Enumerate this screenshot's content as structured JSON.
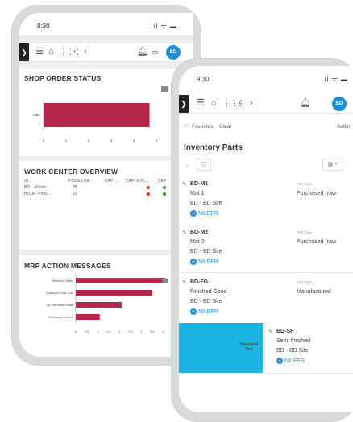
{
  "back_phone": {
    "time": "9:30",
    "signal": ".ıl ᯤ ▬",
    "avatar": "BD",
    "shop_order": {
      "title": "SHOP ORDER STATUS",
      "bar_label": "Late",
      "value": 4.7,
      "ticks": [
        "0",
        "1",
        "2",
        "3",
        "4",
        "5",
        "6"
      ]
    },
    "work_center": {
      "title": "WORK CENTER OVERVIEW",
      "headers": [
        "ID",
        "PIOUE LOA...",
        "CAP. ...",
        "CAP. % PI...",
        "CAP"
      ],
      "rows": [
        {
          "id": "BD1 - Produ...",
          "load": "25",
          "c1": "red",
          "c2": "green"
        },
        {
          "id": "BD1A - Prod...",
          "load": "13",
          "c1": "red",
          "c2": "green"
        }
      ]
    },
    "mrp": {
      "title": "MRP ACTION MESSAGES",
      "ticks": [
        "0",
        "0.5",
        "1",
        "1.5",
        "2",
        "2.5",
        "3",
        "3.5",
        "4",
        "4.5"
      ],
      "bar_color": "#b5264a"
    }
  },
  "chart_data": [
    {
      "type": "bar",
      "title": "SHOP ORDER STATUS",
      "categories": [
        "Late"
      ],
      "values": [
        4.7
      ],
      "xlim": [
        0,
        6
      ]
    },
    {
      "type": "bar",
      "title": "MRP ACTION MESSAGES",
      "categories": [
        "Remove Order",
        "Supply in Past Due",
        "No Demand Exists",
        "Excess of Orders"
      ],
      "values": [
        4.1,
        3.5,
        2.1,
        1.1
      ],
      "xlim": [
        0,
        4.5
      ]
    }
  ],
  "front_phone": {
    "time": "9:30",
    "signal": ".ıl ᯤ ▬",
    "avatar": "BD",
    "favorites": "Favorites",
    "clear": "Clear",
    "settings": "Settin",
    "title": "Inventory Parts",
    "part_type_label": "Part Type",
    "items": [
      {
        "id": "BD-M1",
        "desc": "Mat 1",
        "site": "BD - BD Site",
        "type": "Purchased (raw",
        "owner": "NILEFR",
        "initials": "NI"
      },
      {
        "id": "BD-M2",
        "desc": "Mat 2",
        "site": "BD - BD Site",
        "type": "Purchased (raw",
        "owner": "NILEFR",
        "initials": "NI"
      },
      {
        "id": "BD-FG",
        "desc": "Finished Good",
        "site": "BD - BD Site",
        "type": "Manufactured",
        "owner": "NILEFR",
        "initials": "NI"
      },
      {
        "id": "BD-SF",
        "desc": "Semi finished",
        "site": "BD - BD Site",
        "type": "",
        "owner": "NILEFR",
        "initials": "NI"
      }
    ],
    "swipe_label": "Document\nText"
  }
}
